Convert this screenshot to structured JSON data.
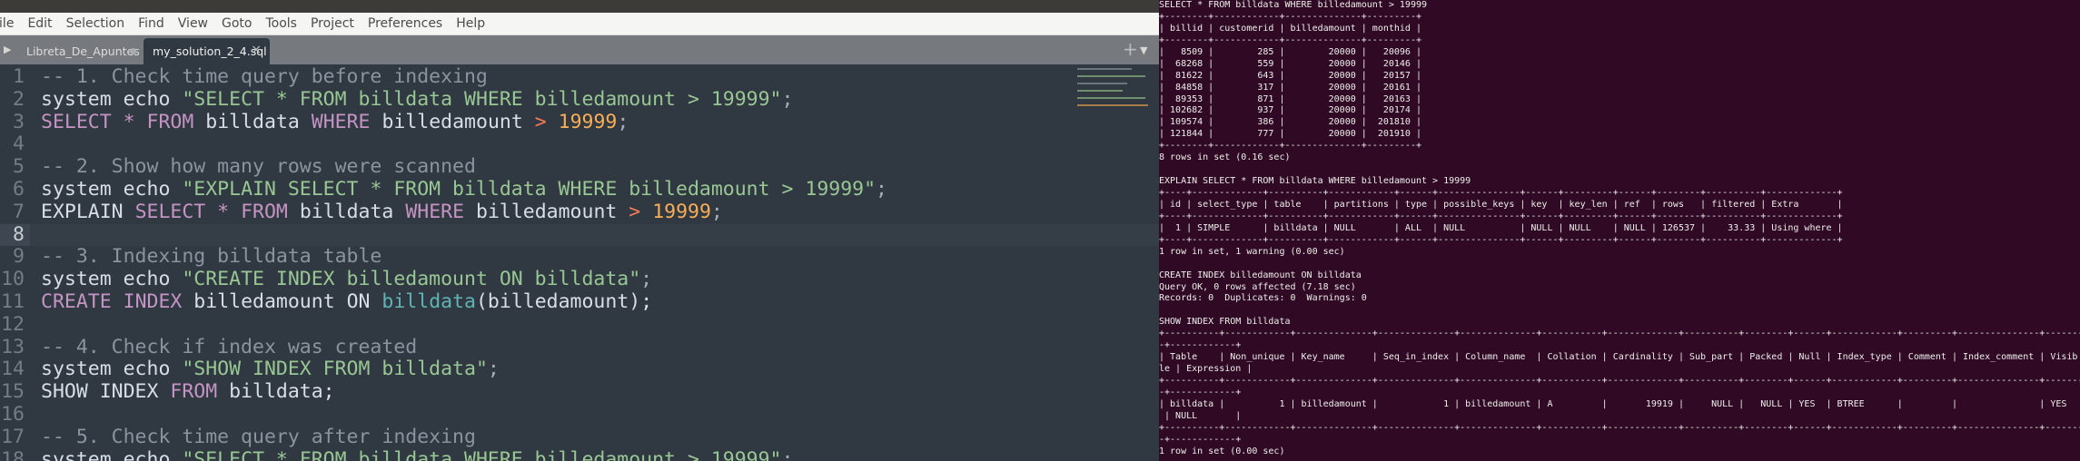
{
  "editor": {
    "menu": [
      "File",
      "Edit",
      "Selection",
      "Find",
      "View",
      "Goto",
      "Tools",
      "Project",
      "Preferences",
      "Help"
    ],
    "tabs": [
      {
        "label": "Libreta_De_Apuntes",
        "state": "modified"
      },
      {
        "label": "my_solution_2_4.sql",
        "state": "active",
        "close": "×"
      }
    ],
    "tab_add": "+",
    "tab_menu": "▼",
    "current_line": 8,
    "colors": {
      "background": "#303841",
      "comment": "#8a949f",
      "string": "#99c794",
      "keyword": "#c594c5",
      "number": "#f9ae58",
      "operator": "#f97b58",
      "function": "#5fb4b4"
    },
    "lines": [
      [
        {
          "type": "c",
          "text": "-- 1. Check time query before indexing"
        }
      ],
      [
        {
          "type": "t",
          "text": "system echo "
        },
        {
          "type": "s",
          "text": "\"SELECT * FROM billdata WHERE billedamount > 19999\""
        },
        {
          "type": "p",
          "text": ";"
        }
      ],
      [
        {
          "type": "k",
          "text": "SELECT"
        },
        {
          "type": "t",
          "text": " "
        },
        {
          "type": "k",
          "text": "*"
        },
        {
          "type": "t",
          "text": " "
        },
        {
          "type": "k",
          "text": "FROM"
        },
        {
          "type": "t",
          "text": " billdata "
        },
        {
          "type": "k",
          "text": "WHERE"
        },
        {
          "type": "t",
          "text": " billedamount "
        },
        {
          "type": "o",
          "text": ">"
        },
        {
          "type": "t",
          "text": " "
        },
        {
          "type": "n",
          "text": "19999"
        },
        {
          "type": "p",
          "text": ";"
        }
      ],
      [],
      [
        {
          "type": "c",
          "text": "-- 2. Show how many rows were scanned"
        }
      ],
      [
        {
          "type": "t",
          "text": "system echo "
        },
        {
          "type": "s",
          "text": "\"EXPLAIN SELECT * FROM billdata WHERE billedamount > 19999\""
        },
        {
          "type": "p",
          "text": ";"
        }
      ],
      [
        {
          "type": "t",
          "text": "EXPLAIN "
        },
        {
          "type": "k",
          "text": "SELECT"
        },
        {
          "type": "t",
          "text": " "
        },
        {
          "type": "k",
          "text": "*"
        },
        {
          "type": "t",
          "text": " "
        },
        {
          "type": "k",
          "text": "FROM"
        },
        {
          "type": "t",
          "text": " billdata "
        },
        {
          "type": "k",
          "text": "WHERE"
        },
        {
          "type": "t",
          "text": " billedamount "
        },
        {
          "type": "o",
          "text": ">"
        },
        {
          "type": "t",
          "text": " "
        },
        {
          "type": "n",
          "text": "19999"
        },
        {
          "type": "p",
          "text": ";"
        }
      ],
      [],
      [
        {
          "type": "c",
          "text": "-- 3. Indexing billdata table"
        }
      ],
      [
        {
          "type": "t",
          "text": "system echo "
        },
        {
          "type": "s",
          "text": "\"CREATE INDEX billedamount ON billdata\""
        },
        {
          "type": "p",
          "text": ";"
        }
      ],
      [
        {
          "type": "k",
          "text": "CREATE"
        },
        {
          "type": "t",
          "text": " "
        },
        {
          "type": "k",
          "text": "INDEX"
        },
        {
          "type": "t",
          "text": " billedamount ON "
        },
        {
          "type": "f",
          "text": "billdata"
        },
        {
          "type": "t",
          "text": "(billedamount);"
        }
      ],
      [],
      [
        {
          "type": "c",
          "text": "-- 4. Check if index was created"
        }
      ],
      [
        {
          "type": "t",
          "text": "system echo "
        },
        {
          "type": "s",
          "text": "\"SHOW INDEX FROM billdata\""
        },
        {
          "type": "p",
          "text": ";"
        }
      ],
      [
        {
          "type": "t",
          "text": "SHOW INDEX "
        },
        {
          "type": "k",
          "text": "FROM"
        },
        {
          "type": "t",
          "text": " billdata;"
        }
      ],
      [],
      [
        {
          "type": "c",
          "text": "-- 5. Check time query after indexing"
        }
      ],
      [
        {
          "type": "t",
          "text": "system echo "
        },
        {
          "type": "s",
          "text": "\"SELECT * FROM billdata WHERE billedamount > 19999\""
        },
        {
          "type": "p",
          "text": ";"
        }
      ]
    ]
  },
  "terminal": {
    "background": "#300a24",
    "lines": [
      "SELECT * FROM billdata WHERE billedamount > 19999",
      "+--------+------------+--------------+---------+",
      "| billid | customerid | billedamount | monthid |",
      "+--------+------------+--------------+---------+",
      "|   8509 |        285 |        20000 |   20096 |",
      "|  68268 |        559 |        20000 |   20146 |",
      "|  81622 |        643 |        20000 |   20157 |",
      "|  84858 |        317 |        20000 |   20161 |",
      "|  89353 |        871 |        20000 |   20163 |",
      "| 102682 |        937 |        20000 |   20174 |",
      "| 109574 |        386 |        20000 |  201810 |",
      "| 121844 |        777 |        20000 |  201910 |",
      "+--------+------------+--------------+---------+",
      "8 rows in set (0.16 sec)",
      "",
      "EXPLAIN SELECT * FROM billdata WHERE billedamount > 19999",
      "+----+-------------+----------+------------+------+---------------+------+---------+------+--------+----------+-------------+",
      "| id | select_type | table    | partitions | type | possible_keys | key  | key_len | ref  | rows   | filtered | Extra       |",
      "+----+-------------+----------+------------+------+---------------+------+---------+------+--------+----------+-------------+",
      "|  1 | SIMPLE      | billdata | NULL       | ALL  | NULL          | NULL | NULL    | NULL | 126537 |    33.33 | Using where |",
      "+----+-------------+----------+------------+------+---------------+------+---------+------+--------+----------+-------------+",
      "1 row in set, 1 warning (0.00 sec)",
      "",
      "CREATE INDEX billedamount ON billdata",
      "Query OK, 0 rows affected (7.18 sec)",
      "Records: 0  Duplicates: 0  Warnings: 0",
      "",
      "SHOW INDEX FROM billdata",
      "+----------+------------+--------------+--------------+--------------+-----------+-------------+----------+--------+------+------------+---------+---------------+--------",
      "-+------------+",
      "| Table    | Non_unique | Key_name     | Seq_in_index | Column_name  | Collation | Cardinality | Sub_part | Packed | Null | Index_type | Comment | Index_comment | Visib",
      "le | Expression |",
      "+----------+------------+--------------+--------------+--------------+-----------+-------------+----------+--------+------+------------+---------+---------------+--------",
      "-+------------+",
      "| billdata |          1 | billedamount |            1 | billedamount | A         |       19919 |     NULL |   NULL | YES  | BTREE      |         |               | YES    ",
      " | NULL       |",
      "+----------+------------+--------------+--------------+--------------+-----------+-------------+----------+--------+------+------------+---------+---------------+--------",
      "-+------------+",
      "1 row in set (0.00 sec)"
    ]
  }
}
